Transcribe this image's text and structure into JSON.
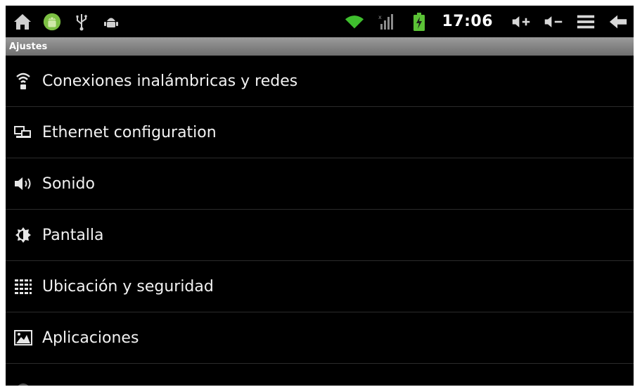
{
  "status_bar": {
    "left_icons": [
      "home-icon",
      "android-icon",
      "usb-icon",
      "debug-icon"
    ],
    "right_icons": [
      "wifi-icon",
      "signal-icon",
      "battery-icon"
    ],
    "time": "17:06",
    "controls": [
      "volume-up-icon",
      "volume-down-icon",
      "menu-icon",
      "back-icon"
    ]
  },
  "header": {
    "title": "Ajustes"
  },
  "settings": {
    "items": [
      {
        "label": "Conexiones inalámbricas y redes",
        "icon": "wireless-icon"
      },
      {
        "label": "Ethernet configuration",
        "icon": "ethernet-icon"
      },
      {
        "label": "Sonido",
        "icon": "sound-icon"
      },
      {
        "label": "Pantalla",
        "icon": "display-icon"
      },
      {
        "label": "Ubicación y seguridad",
        "icon": "location-security-icon"
      },
      {
        "label": "Aplicaciones",
        "icon": "applications-icon"
      }
    ]
  },
  "colors": {
    "background": "#000000",
    "title_bar": "#8a8a8a",
    "battery": "#5bc236",
    "wifi": "#3fbf2e"
  }
}
